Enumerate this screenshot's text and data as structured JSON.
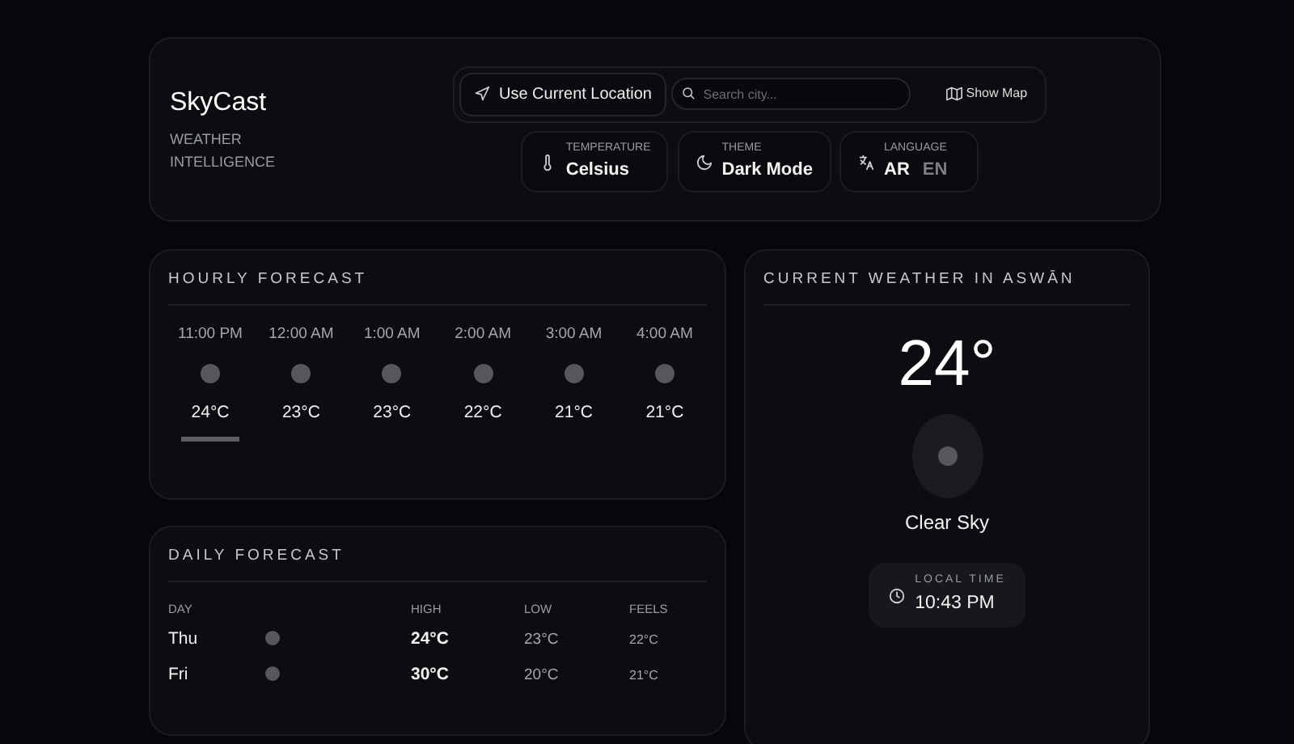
{
  "brand": {
    "name": "SkyCast",
    "tagline": "WEATHER INTELLIGENCE"
  },
  "toolbar": {
    "location_button": "Use Current Location",
    "search": {
      "placeholder": "Search city..."
    },
    "map_button": "Show Map"
  },
  "settings": [
    {
      "kind": "temperature",
      "label": "TEMPERATURE",
      "value": "Celsius"
    },
    {
      "kind": "theme",
      "label": "THEME",
      "value": "Dark Mode"
    },
    {
      "kind": "language",
      "label": "LANGUAGE",
      "options": [
        {
          "label": "AR",
          "selected": true
        },
        {
          "label": "EN",
          "selected": false
        }
      ]
    }
  ],
  "hourly": {
    "title": "HOURLY FORECAST",
    "items": [
      {
        "time": "11:00 PM",
        "temp": "24°C",
        "selected": true
      },
      {
        "time": "12:00 AM",
        "temp": "23°C",
        "selected": false
      },
      {
        "time": "1:00 AM",
        "temp": "23°C",
        "selected": false
      },
      {
        "time": "2:00 AM",
        "temp": "22°C",
        "selected": false
      },
      {
        "time": "3:00 AM",
        "temp": "21°C",
        "selected": false
      },
      {
        "time": "4:00 AM",
        "temp": "21°C",
        "selected": false
      }
    ]
  },
  "daily": {
    "title": "DAILY FORECAST",
    "columns": [
      "DAY",
      "HIGH",
      "LOW",
      "FEELS"
    ],
    "rows": [
      {
        "day": "Thu",
        "high": "24°C",
        "low": "23°C",
        "feels": "22°C"
      },
      {
        "day": "Fri",
        "high": "30°C",
        "low": "20°C",
        "feels": "21°C"
      }
    ]
  },
  "current": {
    "title": "CURRENT WEATHER IN ASWĀN",
    "temperature": "24°",
    "condition": "Clear Sky",
    "local_time_label": "LOCAL TIME",
    "local_time": "10:43 PM"
  }
}
